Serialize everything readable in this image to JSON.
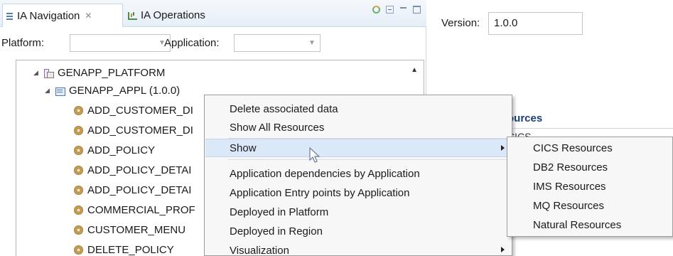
{
  "tabs": [
    {
      "label": "IA Navigation",
      "icon": "navigation-view-icon",
      "close": "✕",
      "active": true
    },
    {
      "label": "IA Operations",
      "icon": "operations-view-icon",
      "active": false
    }
  ],
  "view_toolbar": {
    "icons": [
      "sync-icon",
      "collapse-all-icon",
      "minimize-icon",
      "maximize-icon"
    ]
  },
  "filters": {
    "platform_label": "Platform:",
    "platform_value": "",
    "application_label": "Application:",
    "application_value": ""
  },
  "tree": {
    "nodes": [
      {
        "label": "GENAPP_PLATFORM",
        "expanded": true,
        "icon": "platform-icon"
      },
      {
        "label": "GENAPP_APPL (1.0.0)",
        "expanded": true,
        "icon": "application-icon"
      },
      {
        "label": "ADD_CUSTOMER_DI",
        "icon": "transaction-gear-icon"
      },
      {
        "label": "ADD_CUSTOMER_DI",
        "icon": "transaction-gear-icon"
      },
      {
        "label": "ADD_POLICY",
        "icon": "transaction-gear-icon"
      },
      {
        "label": "ADD_POLICY_DETAI",
        "icon": "transaction-gear-icon"
      },
      {
        "label": "ADD_POLICY_DETAI",
        "icon": "transaction-gear-icon"
      },
      {
        "label": "COMMERCIAL_PROF",
        "icon": "transaction-gear-icon"
      },
      {
        "label": "CUSTOMER_MENU",
        "icon": "transaction-gear-icon"
      },
      {
        "label": "DELETE_POLICY",
        "icon": "transaction-gear-icon"
      }
    ]
  },
  "editor": {
    "version_label": "Version:",
    "version_value": "1.0.0",
    "section_title": "ources",
    "section_desc": "CICS"
  },
  "context_menu": {
    "items": [
      {
        "label": "Delete associated data"
      },
      {
        "label": "Show All Resources"
      },
      {
        "label": "Show",
        "submenu": true,
        "highlighted": true
      },
      {
        "label": "Application dependencies by Application"
      },
      {
        "label": "Application Entry points by Application"
      },
      {
        "label": "Deployed in Platform"
      },
      {
        "label": "Deployed in Region"
      },
      {
        "label": "Visualization",
        "submenu": true
      }
    ]
  },
  "show_submenu": {
    "items": [
      {
        "label": "CICS Resources"
      },
      {
        "label": "DB2 Resources"
      },
      {
        "label": "IMS Resources"
      },
      {
        "label": "MQ Resources"
      },
      {
        "label": "Natural Resources"
      }
    ]
  },
  "colors": {
    "highlight": "#dbe8f7",
    "section_title": "#1b3f74",
    "menu_bg": "#f7f7f7"
  }
}
